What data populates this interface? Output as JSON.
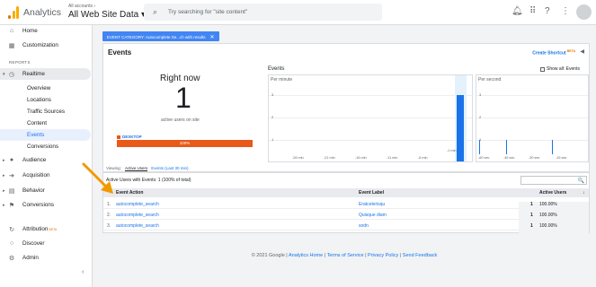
{
  "topbar": {
    "app_name": "Analytics",
    "account_small": "All accounts ›",
    "account_big": "All Web Site Data ▾",
    "search_placeholder": "Try searching for \"site content\""
  },
  "sidebar": {
    "items": [
      {
        "label": "Home",
        "icon": "home-icon"
      },
      {
        "label": "Customization",
        "icon": "customization-icon"
      }
    ],
    "reports_label": "REPORTS",
    "realtime": {
      "label": "Realtime",
      "icon": "clock-icon"
    },
    "realtime_sub": [
      "Overview",
      "Locations",
      "Traffic Sources",
      "Content",
      "Events",
      "Conversions"
    ],
    "sections": [
      {
        "label": "Audience",
        "icon": "person-icon"
      },
      {
        "label": "Acquisition",
        "icon": "acquisition-icon"
      },
      {
        "label": "Behavior",
        "icon": "behavior-icon"
      },
      {
        "label": "Conversions",
        "icon": "flag-icon"
      }
    ],
    "bottom": [
      {
        "label": "Attribution",
        "beta": "BETA",
        "icon": "attribution-icon"
      },
      {
        "label": "Discover",
        "icon": "bulb-icon"
      },
      {
        "label": "Admin",
        "icon": "gear-icon"
      }
    ],
    "collapse": "‹"
  },
  "filter": {
    "label": "EVENT CATEGORY: Autocomplete Se...ch with results",
    "close": "✕"
  },
  "events": {
    "title": "Events",
    "shortcut": "Create Shortcut",
    "shortcut_beta": "BETA",
    "right_now": "Right now",
    "active_users": "1",
    "active_users_label": "active users on site",
    "device_label": "DESKTOP",
    "device_pct": "100%",
    "charts_title": "Events",
    "show_all": "Show all: Events",
    "per_minute": "Per minute",
    "per_second": "Per second",
    "minute_y_ticks": [
      "3",
      "2",
      "1"
    ],
    "second_y_ticks": [
      "3",
      "2",
      "1"
    ],
    "minute_x_ticks": [
      "-26 min",
      "-21 min",
      "-16 min",
      "-11 min",
      "-6 min",
      "-1 min"
    ],
    "second_x_ticks": [
      "-60 sec",
      "-45 sec",
      "-30 sec",
      "-15 sec"
    ]
  },
  "chart_data": [
    {
      "type": "bar",
      "title": "Per minute",
      "x_label_last": "-1 min",
      "bars": [
        {
          "x": -1,
          "value": 3
        }
      ],
      "ylim": [
        0,
        3
      ]
    },
    {
      "type": "bar",
      "title": "Per second",
      "bars": [
        {
          "x": -58,
          "value": 1
        },
        {
          "x": -42,
          "value": 1
        },
        {
          "x": -15,
          "value": 1
        }
      ],
      "ylim": [
        0,
        3
      ]
    }
  ],
  "viewing": {
    "label": "Viewing:",
    "tab1": "Active Users",
    "tab2": "Events (Last 30 min)"
  },
  "table": {
    "summary": "Active Users with Events: 1 (100% of total)",
    "search_icon": "🔍",
    "headers": [
      "Event Action",
      "Event Label",
      "Active Users"
    ],
    "rows": [
      {
        "n": "1.",
        "action": "autocomplete_search",
        "label": "Eratcelerisqu",
        "users": "1",
        "pct": "100.00%"
      },
      {
        "n": "2.",
        "action": "autocomplete_search",
        "label": "Quisque diam",
        "users": "1",
        "pct": "100.00%"
      },
      {
        "n": "3.",
        "action": "autocomplete_search",
        "label": "sodn",
        "users": "1",
        "pct": "100.00%"
      }
    ]
  },
  "footer": {
    "copyright": "© 2021 Google",
    "links": [
      "Analytics Home",
      "Terms of Service",
      "Privacy Policy",
      "Send Feedback"
    ]
  },
  "colors": {
    "accent": "#1a73e8",
    "device": "#e8591a",
    "arrow": "#f29900"
  }
}
